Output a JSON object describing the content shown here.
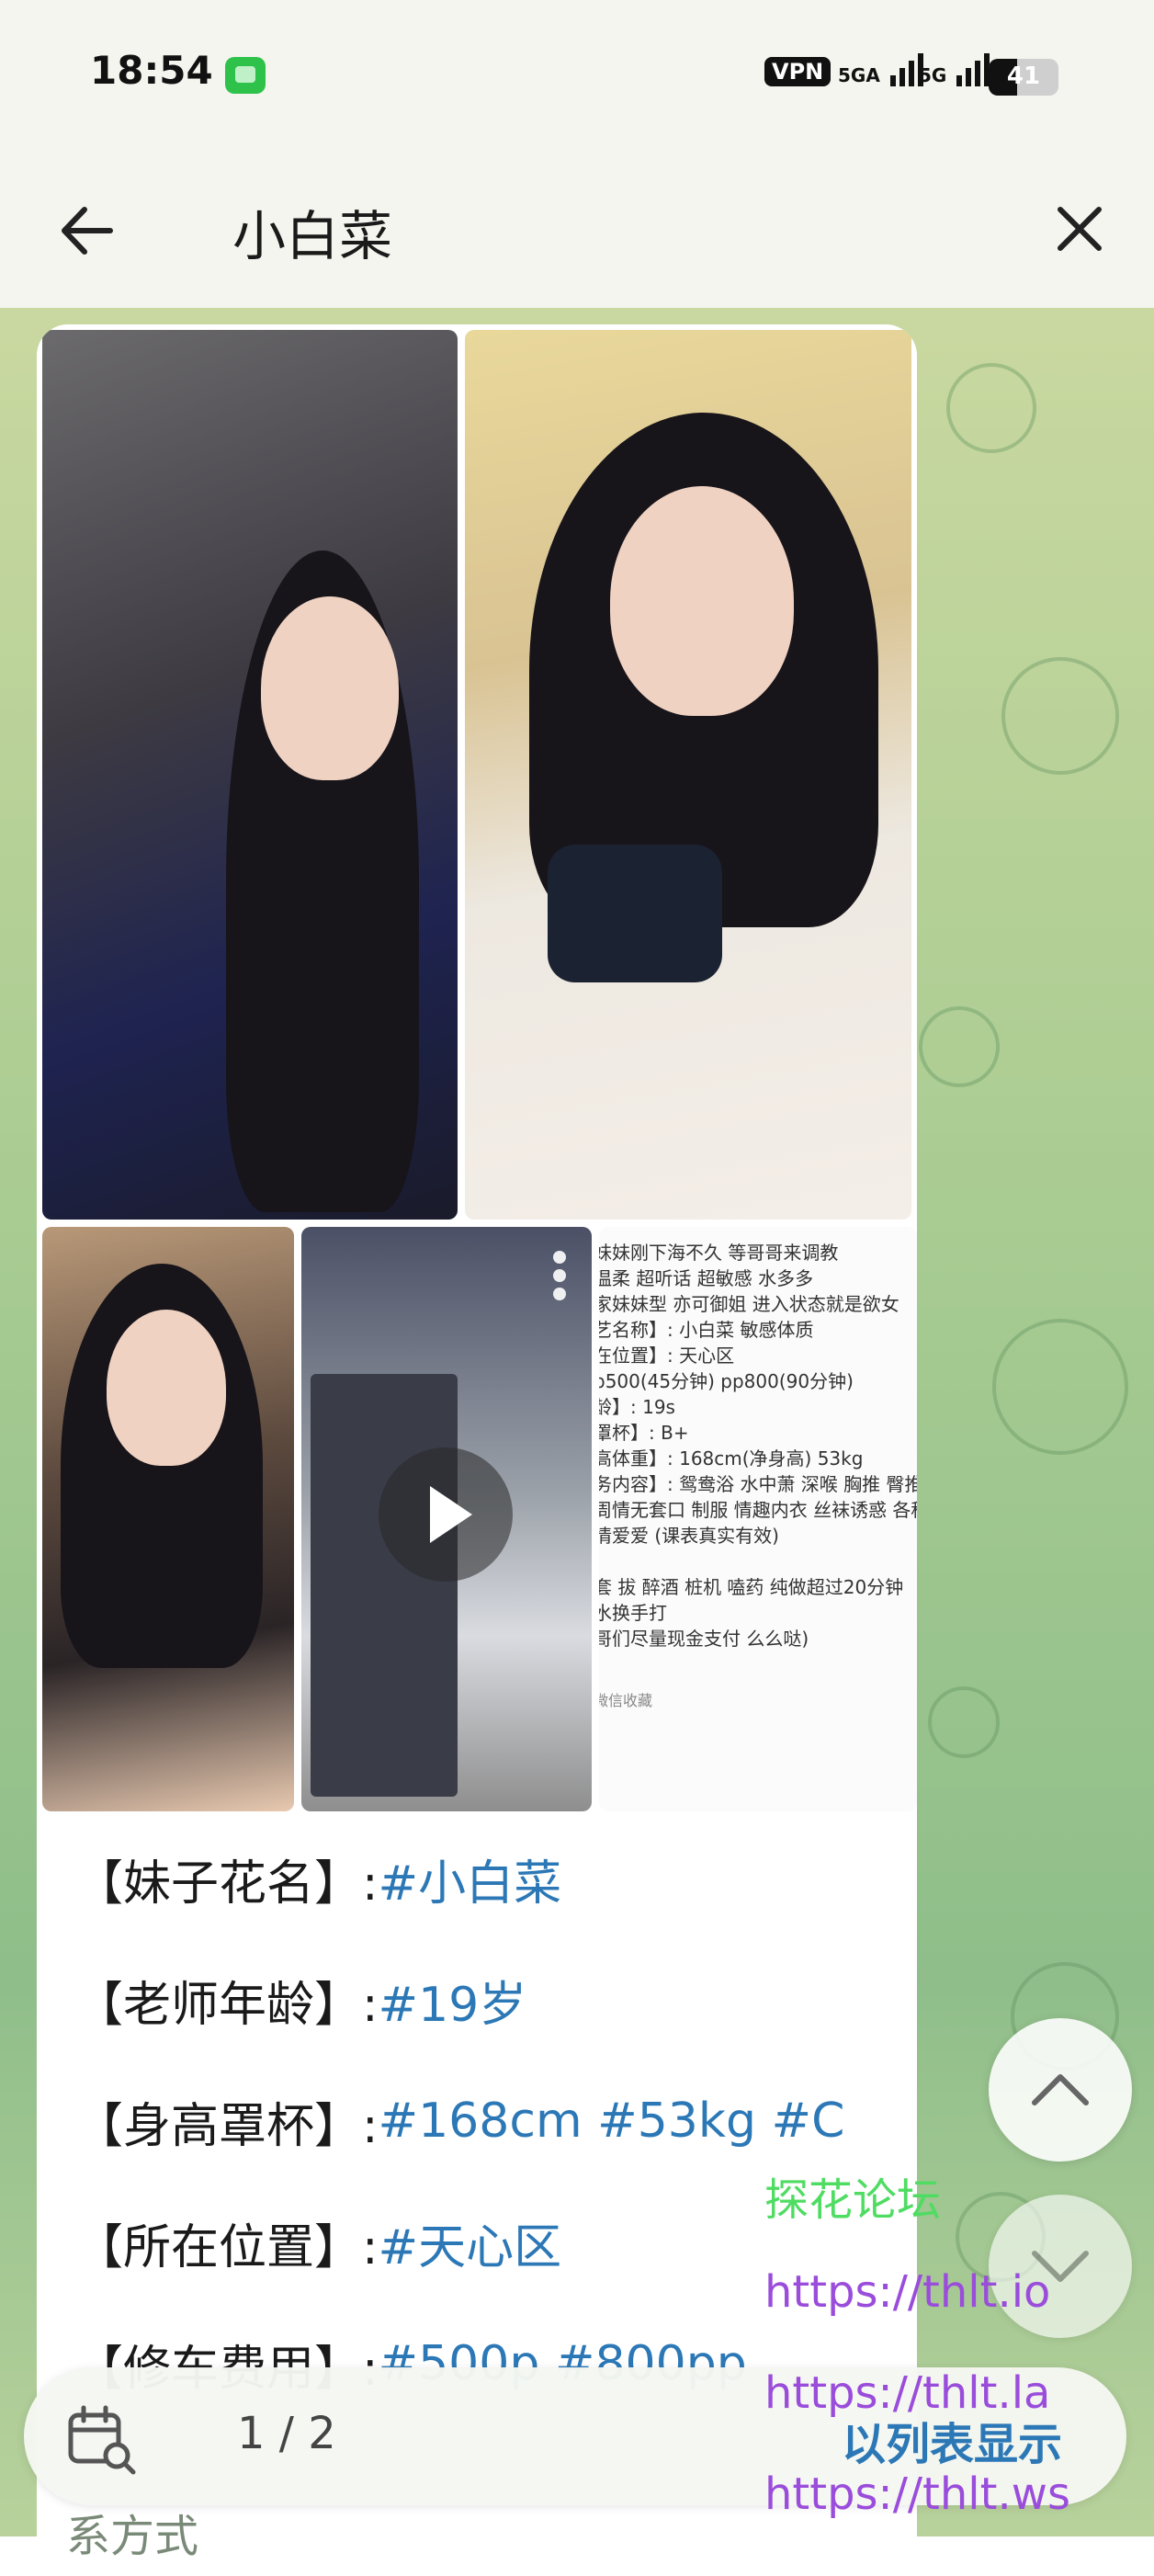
{
  "status_bar": {
    "time": "18:54",
    "vpn_label": "VPN",
    "signal_1": "5GA",
    "signal_2": "5G",
    "battery_level": "41"
  },
  "header": {
    "title": "小白菜"
  },
  "message": {
    "note_lines": [
      "妹妹刚下海不久 等哥哥来调教",
      "温柔 超听话 超敏感 水多多",
      "家妹妹型 亦可御姐 进入状态就是欲女",
      "艺名称】: 小白菜 敏感体质",
      "在位置】: 天心区",
      " p500(45分钟) pp800(90分钟)",
      "龄】: 19s",
      "罩杯】: B+",
      "高体重】: 168cm(净身高) 53kg",
      "务内容】: 鸳鸯浴 水中萧 深喉 胸推 臀推",
      "周情无套口 制服 情趣内衣 丝袜诱惑 各种",
      "情爱爱 (课表真实有效)",
      "",
      "套 拔 醉酒 桩机 嗑药 纯做超过20分钟",
      "水换手打",
      "哥们尽量现金支付 么么哒)"
    ],
    "note_footer": "微信收藏",
    "info_lines": [
      {
        "label": "【妹子花名】: ",
        "value": "#小白菜"
      },
      {
        "label": "【老师年龄】:",
        "value": "#19岁"
      },
      {
        "label": "【身高罩杯】: ",
        "value": "#168cm #53kg #C"
      },
      {
        "label": "【所在位置】: ",
        "value": "#天心区"
      },
      {
        "label": "【修车费用】: ",
        "value": "#500p #800pp"
      }
    ]
  },
  "watermark": {
    "forum_name": "探花论坛",
    "url_1": "https://thlt.io",
    "url_2": "https://thlt.la",
    "url_3": "https://thlt.ws"
  },
  "bottom_bar": {
    "pager": "1 / 2",
    "list_view_label": "以列表显示"
  },
  "partial_text": "系方式",
  "colors": {
    "link": "#2c78b6",
    "watermark_green": "#4fdc62",
    "watermark_purple": "#9a4ddb"
  }
}
